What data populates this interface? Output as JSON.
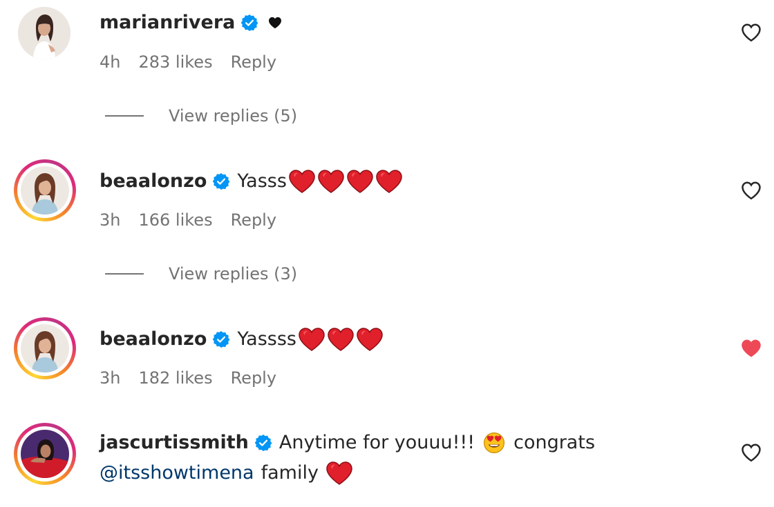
{
  "comments": [
    {
      "username": "marianrivera",
      "text": "",
      "time": "4h",
      "likes": "283 likes",
      "reply": "Reply",
      "liked": false,
      "view_replies": "View replies (5)"
    },
    {
      "username": "beaalonzo",
      "text": "Yasss",
      "time": "3h",
      "likes": "166 likes",
      "reply": "Reply",
      "liked": false,
      "view_replies": "View replies (3)"
    },
    {
      "username": "beaalonzo",
      "text": "Yassss",
      "time": "3h",
      "likes": "182 likes",
      "reply": "Reply",
      "liked": true
    },
    {
      "username": "jascurtissmith",
      "text_part1": "Anytime for youuu!!!",
      "text_part2": "congrats",
      "mention": "@itsshowtimena",
      "text_part3": "family"
    }
  ],
  "colors": {
    "liked_heart": "#ed4956",
    "verified": "#0095f6",
    "mention": "#00376b",
    "muted": "#737373"
  },
  "icons": [
    "verified-badge-icon",
    "heart-outline-icon",
    "heart-filled-icon",
    "red-heart-emoji",
    "black-heart-icon",
    "heart-eyes-emoji"
  ]
}
